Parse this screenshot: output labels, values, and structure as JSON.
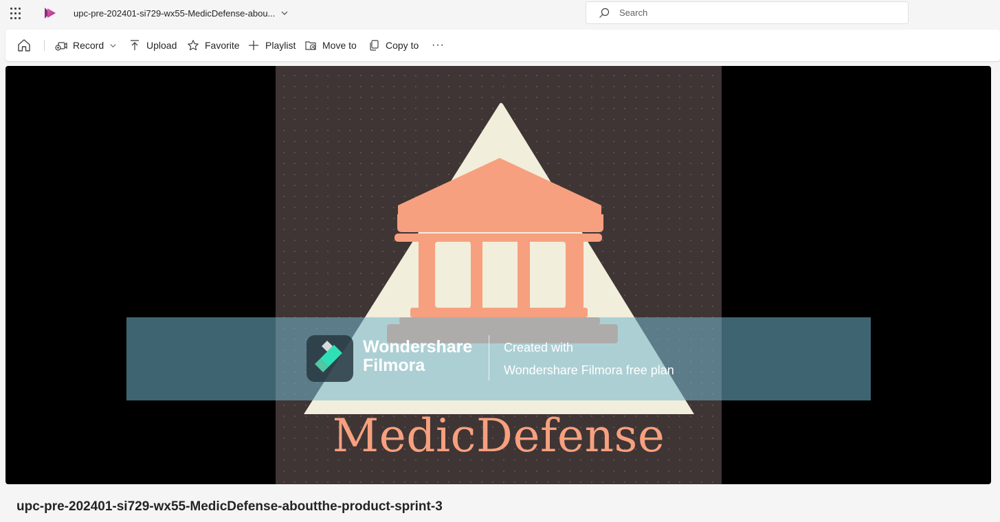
{
  "header": {
    "file_title": "upc-pre-202401-si729-wx55-MedicDefense-abou...",
    "search_placeholder": "Search"
  },
  "toolbar": {
    "record": "Record",
    "upload": "Upload",
    "favorite": "Favorite",
    "playlist": "Playlist",
    "move_to": "Move to",
    "copy_to": "Copy to",
    "more": "···"
  },
  "video": {
    "brand_name": "MedicDefense",
    "watermark": {
      "name_line1": "Wondershare",
      "name_line2": "Filmora",
      "text_line1": "Created with",
      "text_line2": "Wondershare Filmora free plan"
    }
  },
  "video_title": "upc-pre-202401-si729-wx55-MedicDefense-aboutthe-product-sprint-3",
  "colors": {
    "accent_logo": "#c43e9a",
    "frame_background": "#3f3534",
    "triangle": "#f1eedb",
    "building": "#f7a07f",
    "watermark_overlay": "#73b6cd"
  }
}
